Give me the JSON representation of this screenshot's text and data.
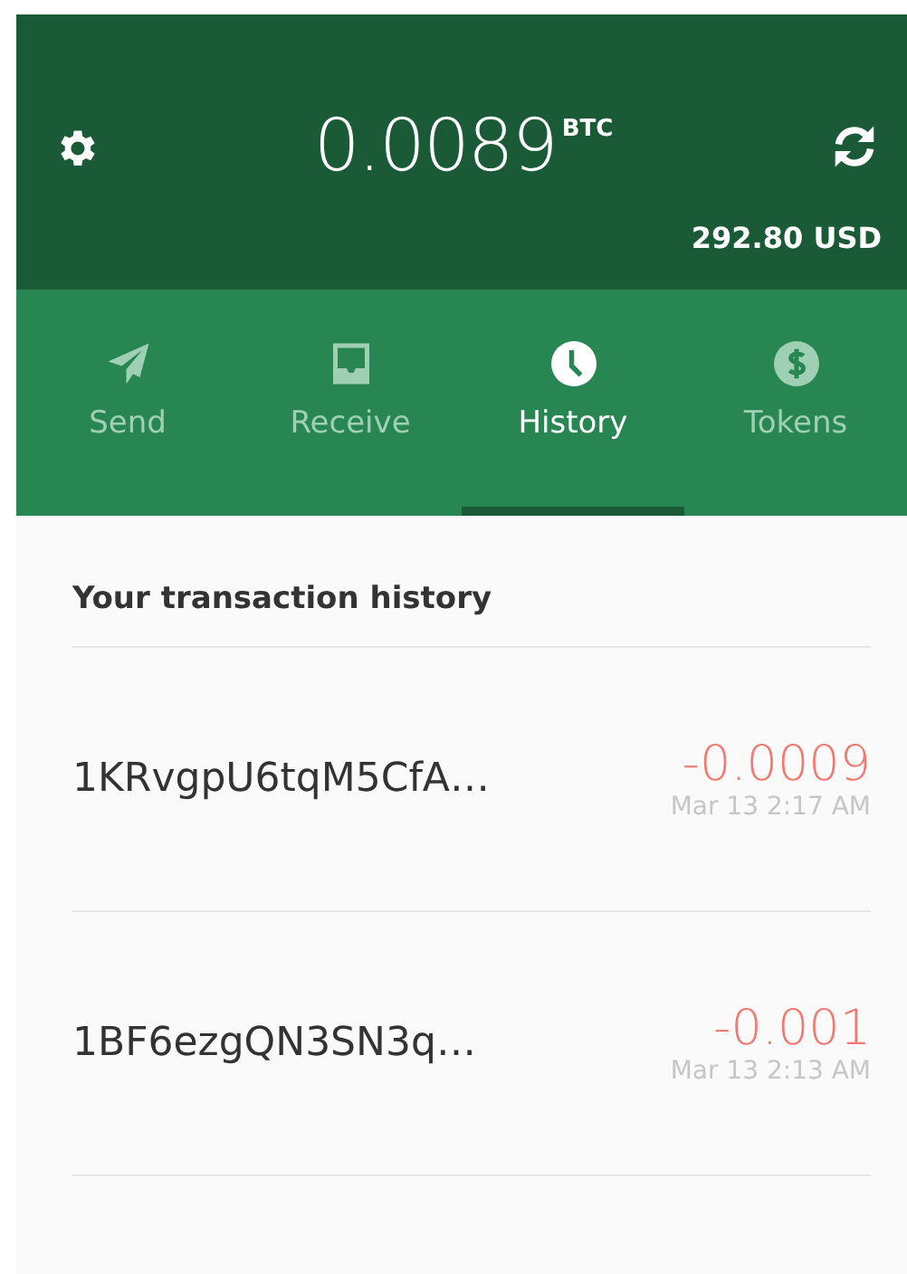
{
  "balance": {
    "amount": "0.0089",
    "unit": "BTC",
    "fiat": "292.80 USD"
  },
  "tabs": [
    {
      "kind": "send",
      "label": "Send",
      "selected": false
    },
    {
      "kind": "receive",
      "label": "Receive",
      "selected": false
    },
    {
      "kind": "history",
      "label": "History",
      "selected": true
    },
    {
      "kind": "tokens",
      "label": "Tokens",
      "selected": false
    }
  ],
  "history": {
    "title": "Your transaction history",
    "transactions": [
      {
        "address": "1KRvgpU6tqM5CfA…",
        "amount": "-0.0009",
        "time": "Mar 13 2:17 AM"
      },
      {
        "address": "1BF6ezgQN3SN3q…",
        "amount": "-0.001",
        "time": "Mar 13 2:13 AM"
      }
    ]
  }
}
